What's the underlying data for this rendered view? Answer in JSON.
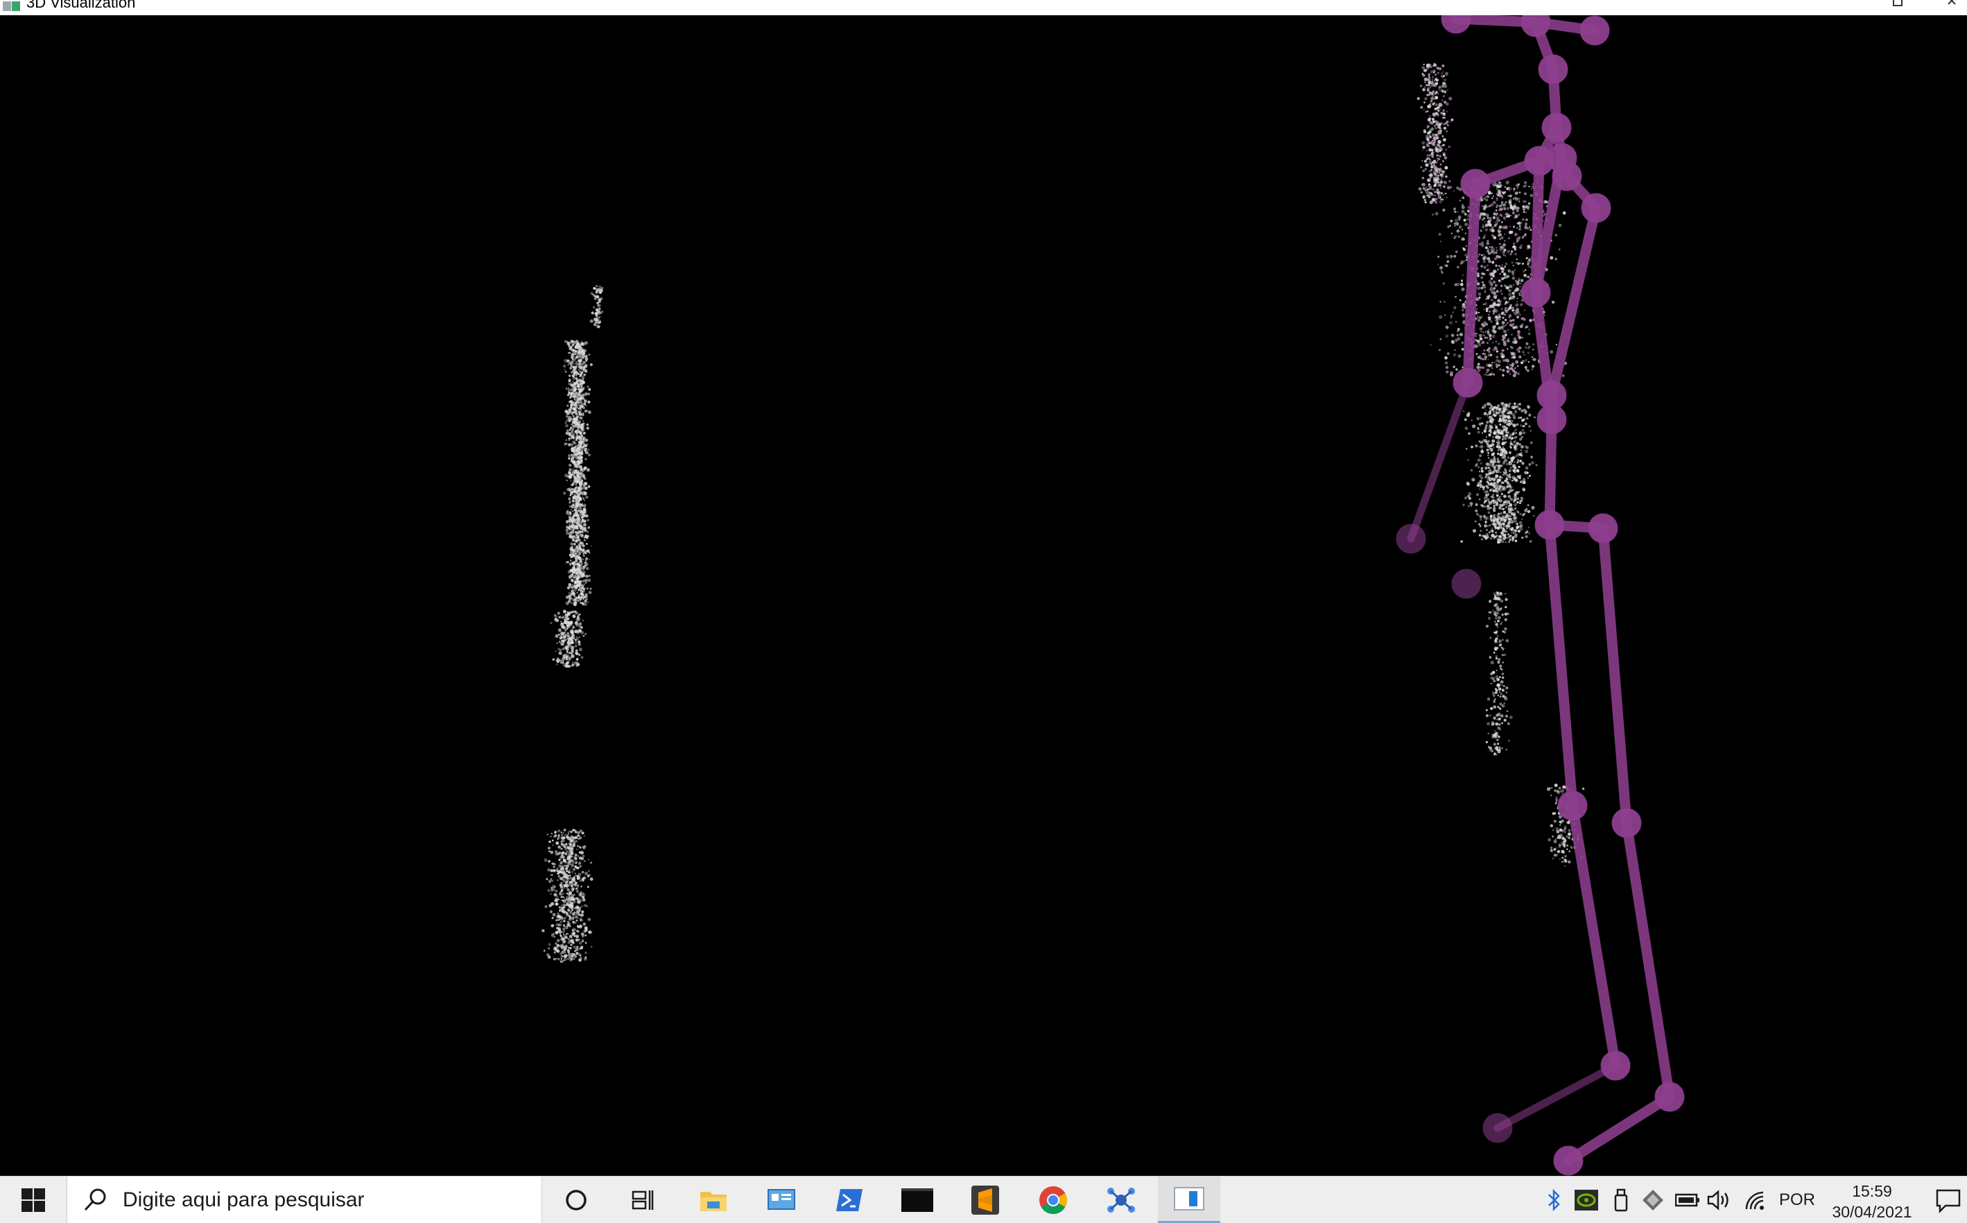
{
  "window": {
    "title": "3D Visualization",
    "icon": "app-window-icon"
  },
  "scene": {
    "background": "#000000",
    "skeleton_color": "#8e3f8e",
    "point_color": "#d8d8d8",
    "objects": [
      "point-cloud-left-tall",
      "point-cloud-left-small",
      "point-cloud-person",
      "skeleton"
    ]
  },
  "taskbar": {
    "search_placeholder": "Digite aqui para pesquisar",
    "pinned": [
      {
        "name": "cortana-icon"
      },
      {
        "name": "task-view-icon"
      },
      {
        "name": "file-explorer-icon"
      },
      {
        "name": "control-panel-icon"
      },
      {
        "name": "powershell-icon"
      },
      {
        "name": "terminal-icon"
      },
      {
        "name": "sublime-text-icon"
      },
      {
        "name": "chrome-icon"
      },
      {
        "name": "network-app-icon"
      },
      {
        "name": "visualization-app-icon"
      }
    ],
    "tray": {
      "language": "POR",
      "time": "15:59",
      "date": "30/04/2021"
    }
  }
}
